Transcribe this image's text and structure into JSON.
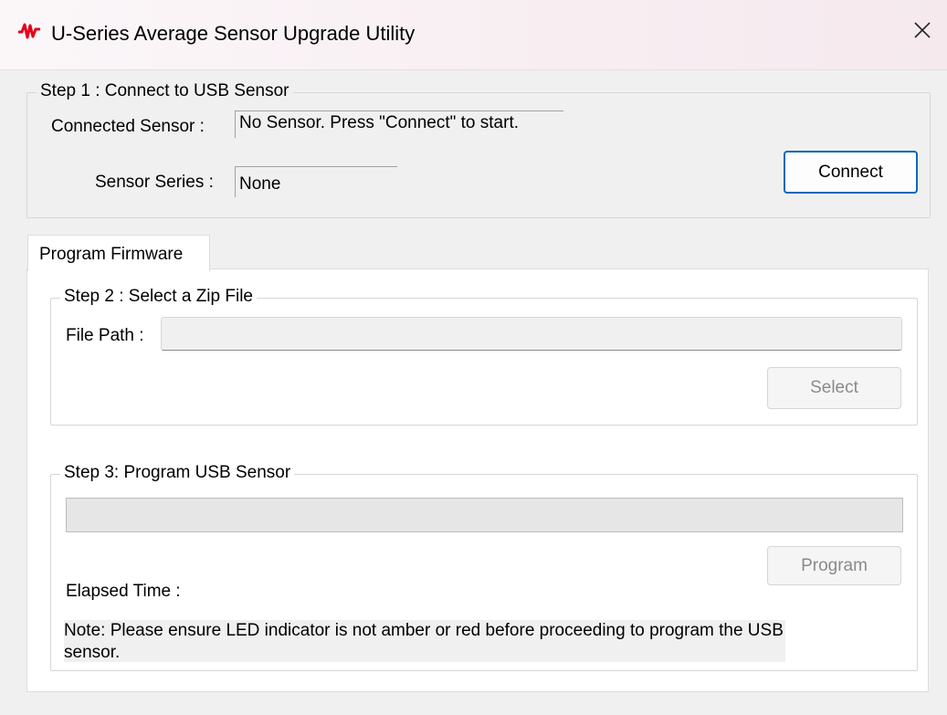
{
  "window": {
    "title": "U-Series Average Sensor Upgrade Utility",
    "app_icon": "waveform-icon",
    "close_icon": "close-icon"
  },
  "step1": {
    "legend": "Step 1 : Connect to USB Sensor",
    "connected_sensor_label": "Connected Sensor :",
    "connected_sensor_value": "No Sensor. Press \"Connect\" to start.",
    "sensor_series_label": "Sensor Series :",
    "sensor_series_value": "None",
    "connect_button": "Connect"
  },
  "tabs": [
    {
      "label": "Program Firmware",
      "selected": true
    }
  ],
  "step2": {
    "legend": "Step 2 : Select a Zip File",
    "file_path_label": "File Path :",
    "file_path_value": "",
    "select_button": "Select"
  },
  "step3": {
    "legend": "Step 3: Program USB Sensor",
    "progress": 0,
    "program_button": "Program",
    "elapsed_time_label": "Elapsed Time :",
    "note": "Note: Please ensure LED indicator is not amber or red before proceeding to program the USB sensor."
  },
  "colors": {
    "accent": "#0067c0",
    "icon_red": "#e3001b",
    "progress_fill": "#06b025"
  }
}
